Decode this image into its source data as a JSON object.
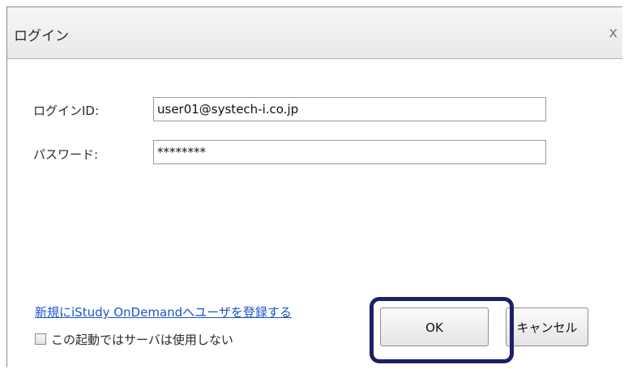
{
  "dialog": {
    "title": "ログイン",
    "close_glyph": "x"
  },
  "form": {
    "login_id_label": "ログインID:",
    "login_id_value": "user01@systech-i.co.jp",
    "password_label": "パスワード:",
    "password_value": "********"
  },
  "footer": {
    "register_link": "新規にiStudy OnDemandへユーザを登録する",
    "offline_checkbox_label": "この起動ではサーバは使用しない",
    "offline_checked": false,
    "ok_label": "OK",
    "cancel_label": "キャンセル"
  },
  "annotation": {
    "highlight_color": "#1d2066"
  }
}
